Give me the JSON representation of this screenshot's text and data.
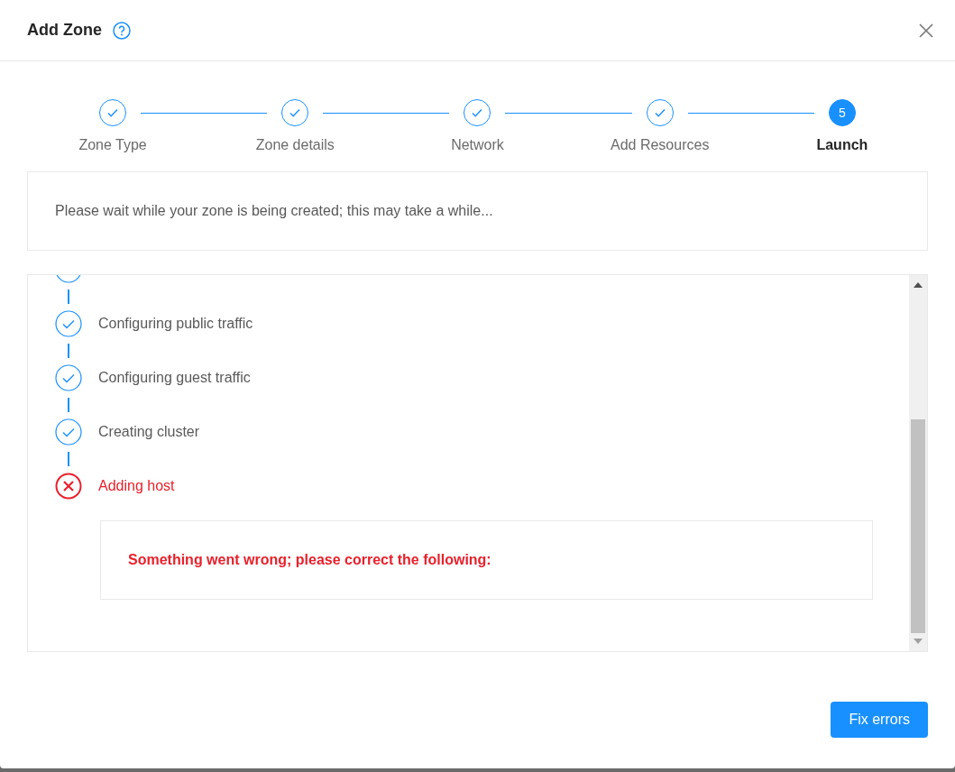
{
  "dialog": {
    "title": "Add Zone"
  },
  "steps": [
    {
      "label": "Zone Type",
      "completed": true
    },
    {
      "label": "Zone details",
      "completed": true
    },
    {
      "label": "Network",
      "completed": true
    },
    {
      "label": "Add Resources",
      "completed": true
    },
    {
      "label": "Launch",
      "completed": false,
      "number": "5"
    }
  ],
  "message": "Please wait while your zone is being created; this may take a while...",
  "progress": [
    {
      "failed": false
    },
    {
      "label": "Configuring public traffic",
      "failed": false
    },
    {
      "label": "Configuring guest traffic",
      "failed": false
    },
    {
      "label": "Creating cluster",
      "failed": false
    },
    {
      "label": "Adding host",
      "failed": true
    }
  ],
  "error_message": "Something went wrong; please correct the following:",
  "buttons": [
    {
      "label": "Fix errors"
    }
  ]
}
